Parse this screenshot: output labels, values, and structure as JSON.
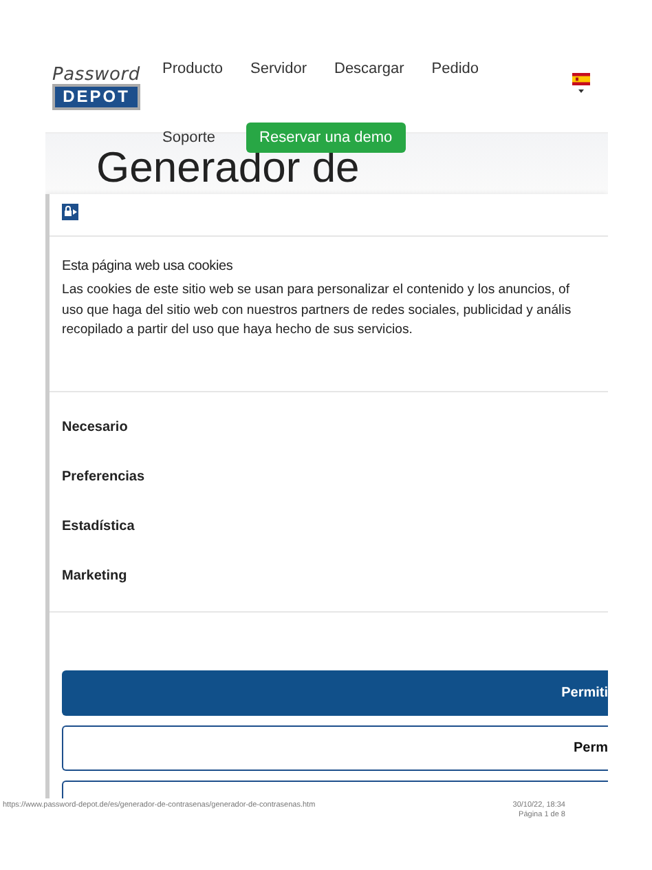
{
  "logo": {
    "line_1": "Password",
    "line_2": "DEPOT"
  },
  "nav": [
    {
      "label": "Producto"
    },
    {
      "label": "Servidor"
    },
    {
      "label": "Descargar"
    },
    {
      "label": "Pedido"
    }
  ],
  "nav_row_2": {
    "label": "Soporte",
    "button": "Reservar una demo"
  },
  "page_title": "Generador de",
  "cookie_dialog": {
    "heading": "Esta página web usa cookies",
    "paragraph_lines": [
      "Las cookies de este sitio web se usan para personalizar el contenido y los anuncios, of",
      "uso que haga del sitio web con nuestros partners de redes sociales, publicidad y anális",
      "recopilado a partir del uso que haya hecho de sus servicios."
    ],
    "categories": [
      {
        "label": "Necesario"
      },
      {
        "label": "Preferencias"
      },
      {
        "label": "Estadística"
      },
      {
        "label": "Marketing"
      }
    ],
    "buttons": [
      {
        "label": "Permiti",
        "kind": "primary"
      },
      {
        "label": "Perm",
        "kind": "outline"
      },
      {
        "kind": "outline"
      }
    ]
  },
  "footer": {
    "url": "https://www.password-depot.de/es/generador-de-contrasenas/generador-de-contrasenas.htm",
    "date": "30/10/22, 18:34",
    "page": "Página 1 de 8"
  }
}
